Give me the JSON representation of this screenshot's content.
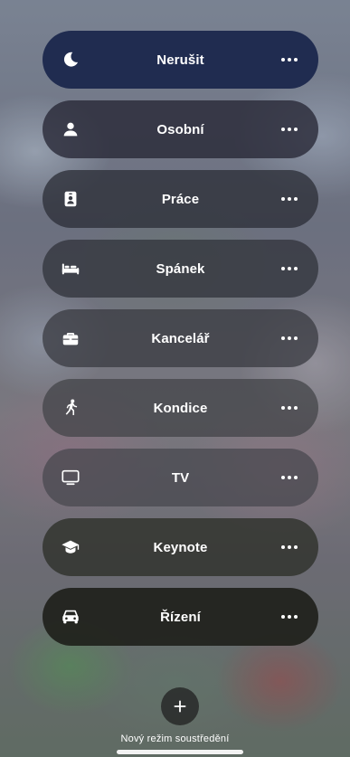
{
  "focus_modes": [
    {
      "label": "Nerušit",
      "icon": "moon-icon",
      "color": "#1f2b4f"
    },
    {
      "label": "Osobní",
      "icon": "person-icon",
      "color": "#2c2c3b"
    },
    {
      "label": "Práce",
      "icon": "id-badge-icon",
      "color": "#343640"
    },
    {
      "label": "Spánek",
      "icon": "bed-icon",
      "color": "#383a42"
    },
    {
      "label": "Kancelář",
      "icon": "briefcase-icon",
      "color": "#3d3e46"
    },
    {
      "label": "Kondice",
      "icon": "running-icon",
      "color": "#45464c"
    },
    {
      "label": "TV",
      "icon": "tv-icon",
      "color": "#4a4a4f"
    },
    {
      "label": "Keynote",
      "icon": "graduation-cap-icon",
      "color": "#33352f"
    },
    {
      "label": "Řízení",
      "icon": "car-icon",
      "color": "#24251f"
    }
  ],
  "add_button": {
    "label": "Nový režim soustředění",
    "icon": "plus-icon"
  }
}
